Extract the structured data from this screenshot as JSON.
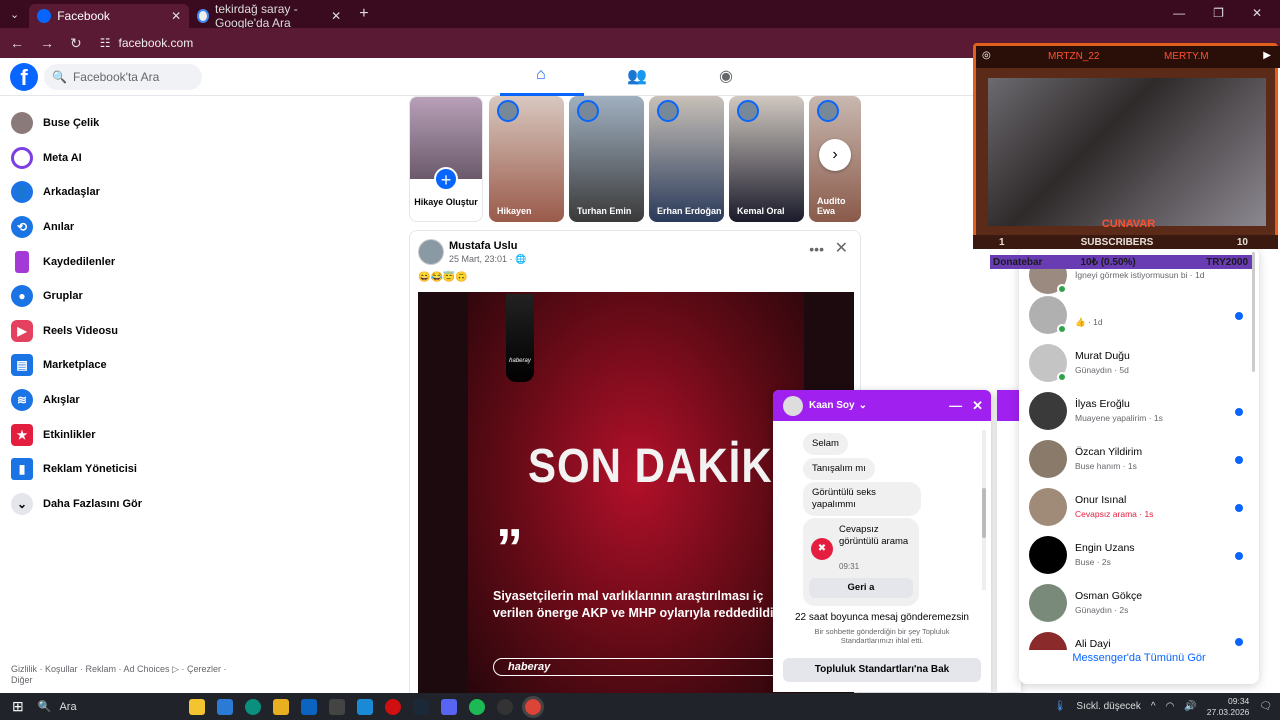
{
  "browser": {
    "tabs": [
      {
        "title": "Facebook",
        "active": true
      },
      {
        "title": "tekirdağ saray - Google'da Ara",
        "active": false
      }
    ],
    "new_tab": "+",
    "url": "facebook.com"
  },
  "header": {
    "search_placeholder": "Facebook'ta Ara"
  },
  "sidebar": {
    "items": [
      {
        "label": "Buse Çelik",
        "icon": "avatar"
      },
      {
        "label": "Meta AI",
        "icon": "meta-ai-icon"
      },
      {
        "label": "Arkadaşlar",
        "icon": "friends-icon"
      },
      {
        "label": "Anılar",
        "icon": "memories-icon"
      },
      {
        "label": "Kaydedilenler",
        "icon": "saved-icon"
      },
      {
        "label": "Gruplar",
        "icon": "groups-icon"
      },
      {
        "label": "Reels Videosu",
        "icon": "reels-icon"
      },
      {
        "label": "Marketplace",
        "icon": "marketplace-icon"
      },
      {
        "label": "Akışlar",
        "icon": "feeds-icon"
      },
      {
        "label": "Etkinlikler",
        "icon": "events-icon"
      },
      {
        "label": "Reklam Yöneticisi",
        "icon": "ads-manager-icon"
      },
      {
        "label": "Daha Fazlasını Gör",
        "icon": "chevron-down-icon"
      }
    ],
    "footer": "Gizlilik · Koşullar · Reklam · Ad Choices ▷ · Çerezler · Diğer"
  },
  "stories": {
    "create_label": "Hikaye Oluştur",
    "items": [
      {
        "name": "Hikayen"
      },
      {
        "name": "Turhan Emin"
      },
      {
        "name": "Erhan Erdoğan"
      },
      {
        "name": "Kemal Oral"
      },
      {
        "name": "Audito Ewa"
      }
    ]
  },
  "post": {
    "author": "Mustafa Uslu",
    "date": "25 Mart, 23:01 · ",
    "emojis": "😄😂😇🙃",
    "headline": "SON DAKİKA",
    "quote_mark": "”",
    "body_text": "Siyasetçilerin mal varlıklarının araştırılması iç verilen önerge AKP ve MHP oylarıyla reddedildi.",
    "brand": "haberay",
    "portrait_brand": "haberay"
  },
  "chat": {
    "name": "Kaan Soy",
    "messages": [
      "Selam",
      "Tanışalım mı",
      "Görüntülü seks yapalımmı"
    ],
    "missed_call": "Cevapsız görüntülü arama",
    "missed_time": "09:31",
    "callback": "Geri a",
    "notice_title": "22 saat boyunca mesaj gönderemezsin",
    "notice_body": "Bir sohbette gönderdiğin bir şey Topluluk Standartlarımızı ihlal etti.",
    "standards_button": "Topluluk Standartları'na Bak"
  },
  "stream_overlay": {
    "top_left": "MRTZN_22",
    "top_right": "MERTY.M",
    "streamer": "CUNAVAR",
    "subs_left": "1",
    "subs_label": "SUBSCRIBERS",
    "subs_right": "10",
    "donate_label": "Donatebar",
    "donate_progress": "10₺ (0.50%)",
    "donate_goal": "TRY2000"
  },
  "contacts": {
    "items": [
      {
        "name": "",
        "sub": "İgneyi görmek istiyormusun bi · 1d",
        "online": true,
        "unread": false
      },
      {
        "name": "",
        "sub": "👍 · 1d",
        "online": true,
        "unread": true
      },
      {
        "name": "Murat Duğu",
        "sub": "Günaydın · 5d",
        "online": true,
        "unread": false
      },
      {
        "name": "İlyas Eroğlu",
        "sub": "Muayene yapalirim · 1s",
        "online": false,
        "unread": true
      },
      {
        "name": "Özcan Yildirim",
        "sub": "Buse hanım · 1s",
        "online": false,
        "unread": true
      },
      {
        "name": "Onur Isınal",
        "sub": "Cevapsız arama · 1s",
        "online": false,
        "unread": true,
        "missed": true
      },
      {
        "name": "Engin Uzans",
        "sub": "Buse · 2s",
        "online": false,
        "unread": true
      },
      {
        "name": "Osman Gökçe",
        "sub": "Günaydın · 2s",
        "online": false,
        "unread": false
      },
      {
        "name": "Ali Dayi",
        "sub": "",
        "online": false,
        "unread": true
      }
    ],
    "see_all": "Messenger'da Tümünü Gör"
  },
  "taskbar": {
    "search": "Ara",
    "weather": "Sıckl. düşecek",
    "time": "09:34",
    "date": "27.03.2026"
  }
}
